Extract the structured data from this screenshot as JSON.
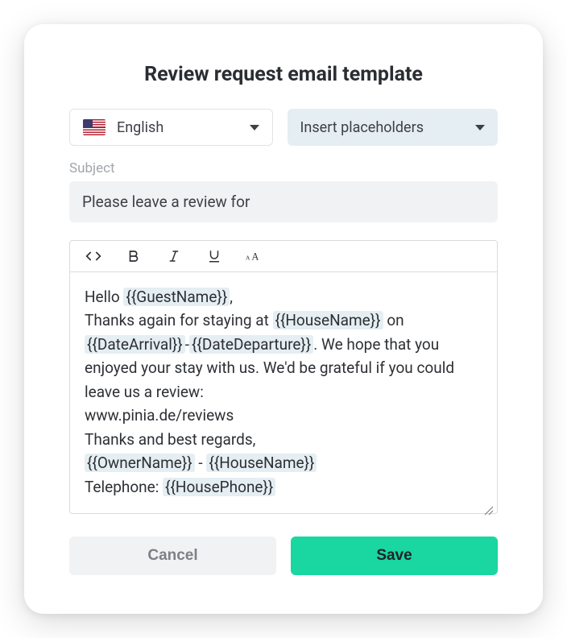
{
  "title": "Review request email template",
  "language": {
    "selected": "English"
  },
  "placeholders_dropdown": {
    "label": "Insert placeholders"
  },
  "subject": {
    "label": "Subject",
    "value": "Please leave a review for"
  },
  "body": {
    "greeting_prefix": "Hello ",
    "guest_name_ph": "{{GuestName}}",
    "greeting_suffix": ",",
    "line2_prefix": "Thanks again for staying at ",
    "house_name_ph": "{{HouseName}}",
    "line2_on": " on ",
    "date_arrival_ph": "{{DateArrival}}",
    "line2_dash": "-",
    "date_departure_ph": "{{DateDeparture}}",
    "line2_suffix": ". We hope that you enjoyed your stay with us. We'd be grateful if you could leave us a review:",
    "url": "www.pinia.de/reviews",
    "regards": "Thanks and best regards,",
    "owner_name_ph": "{{OwnerName}}",
    "owner_sep": " - ",
    "house_name_ph2": "{{HouseName}}",
    "tel_prefix": "Telephone: ",
    "house_phone_ph": "{{HousePhone}}"
  },
  "buttons": {
    "cancel": "Cancel",
    "save": "Save"
  }
}
